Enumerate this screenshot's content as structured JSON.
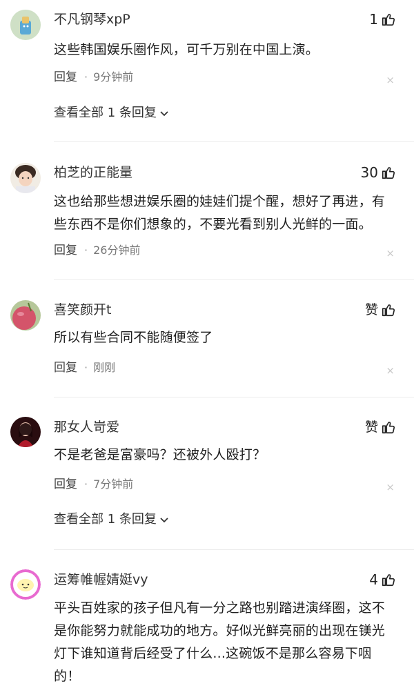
{
  "comments": [
    {
      "username": "不凡钢琴xpP",
      "likes": "1",
      "text": [
        "这些韩国娱乐圈作风，可千万别在中国上演。"
      ],
      "reply_label": "回复",
      "separator": "·",
      "time": "9分钟前",
      "close": "×",
      "view_all": "查看全部 1 条回复"
    },
    {
      "username": "柏芝的正能量",
      "likes": "30",
      "text": [
        "这也给那些想进娱乐圈的娃娃们提个醒，想好了再进，有",
        "些东西不是你们想象的，不要光看到别人光鲜的一面。"
      ],
      "reply_label": "回复",
      "separator": "·",
      "time": "26分钟前",
      "close": "×"
    },
    {
      "username": "喜笑颜开t",
      "likes": "赞",
      "text": [
        "所以有些合同不能随便签了"
      ],
      "reply_label": "回复",
      "separator": "·",
      "time": "刚刚",
      "close": "×"
    },
    {
      "username": "那女人岢爱",
      "likes": "赞",
      "text": [
        "不是老爸是富豪吗？还被外人殴打？"
      ],
      "reply_label": "回复",
      "separator": "·",
      "time": "7分钟前",
      "close": "×",
      "view_all": "查看全部 1 条回复"
    },
    {
      "username": "运筹帷幄婧娗vy",
      "likes": "4",
      "text": [
        "平头百姓家的孩子但凡有一分之路也别踏进演绎圈，这不",
        "是你能努力就能成功的地方。好似光鲜亮丽的出现在镁光",
        "灯下谁知道背后经受了什么...这碗饭不是那么容易下咽",
        "的！"
      ]
    }
  ],
  "icons": {
    "like": "thumbs-up-icon",
    "chevron": "chevron-down-icon",
    "close": "close-icon"
  },
  "colors": {
    "text": "#222222",
    "muted": "#777777",
    "close": "#c8c8c8"
  }
}
